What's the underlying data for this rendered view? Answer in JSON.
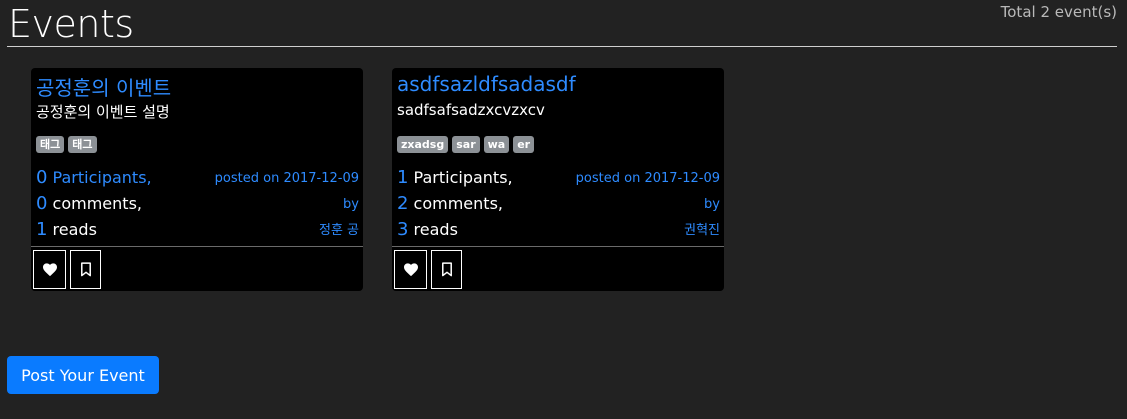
{
  "header": {
    "title": "Events",
    "total": "Total 2 event(s)"
  },
  "events": [
    {
      "title": "공정훈의 이벤트",
      "description": "공정훈의 이벤트 설명",
      "tags": [
        "태그",
        "태그"
      ],
      "participants_count": "0",
      "participants_label": "Participants,",
      "comments_count": "0",
      "comments_label": "comments,",
      "reads_count": "1",
      "reads_label": "reads",
      "posted": "posted on 2017-12-09",
      "by": "by",
      "author": "정훈 공"
    },
    {
      "title": "asdfsazldfsadasdf",
      "description": "sadfsafsadzxcvzxcv",
      "tags": [
        "zxadsg",
        "sar",
        "wa",
        "er"
      ],
      "participants_count": "1",
      "participants_label": "Participants,",
      "comments_count": "2",
      "comments_label": "comments,",
      "reads_count": "3",
      "reads_label": "reads",
      "posted": "posted on 2017-12-09",
      "by": "by",
      "author": "권혁진"
    }
  ],
  "icons": {
    "like": "heart-icon",
    "bookmark": "bookmark-icon"
  },
  "actions": {
    "post_label": "Post Your Event"
  },
  "colors": {
    "background": "#222222",
    "card": "#000000",
    "accent": "#2e8bff",
    "button": "#0a7bff",
    "tag": "#8c9196"
  }
}
